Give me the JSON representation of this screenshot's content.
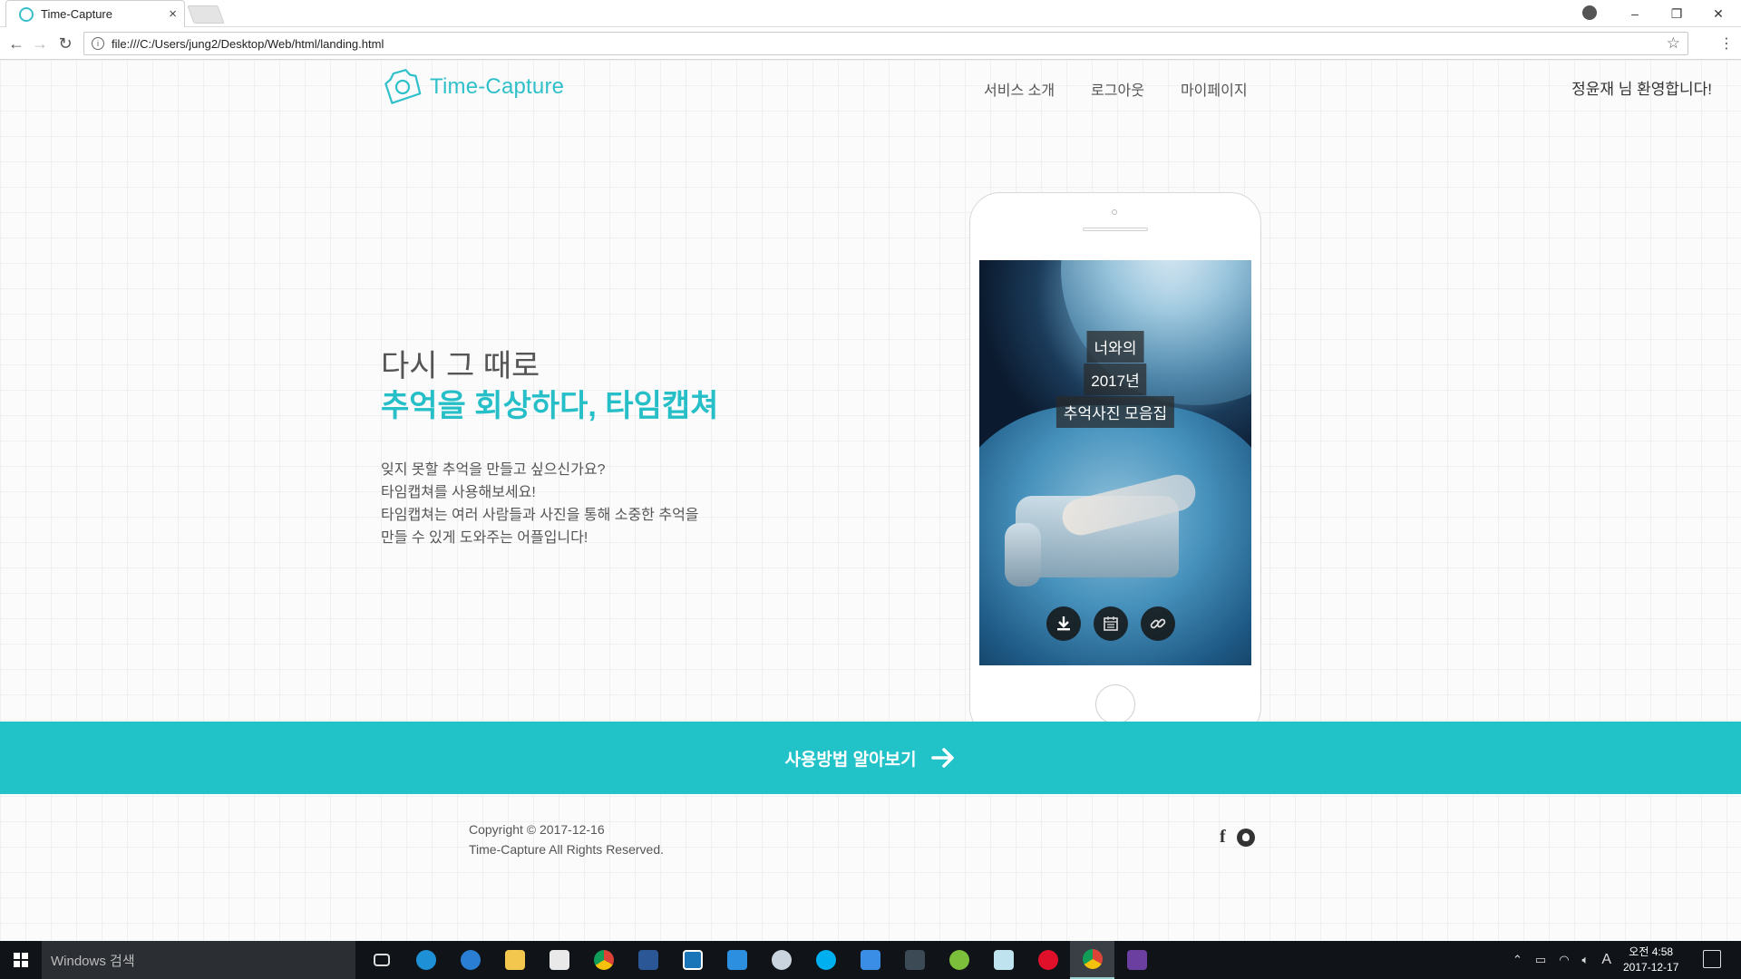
{
  "browser": {
    "tab_title": "Time-Capture",
    "tab_close": "×",
    "address": "file:///C:/Users/jung2/Desktop/Web/html/landing.html",
    "window_controls": [
      "–",
      "❐",
      "✕"
    ]
  },
  "header": {
    "logo_text": "Time-Capture",
    "nav": [
      "서비스 소개",
      "로그아웃",
      "마이페이지"
    ],
    "welcome": "정윤재 님 환영합니다!"
  },
  "hero": {
    "title_line1": "다시 그 때로",
    "title_line2": "추억을 회상하다, 타임캡쳐",
    "desc": [
      "잊지 못할 추억을 만들고 싶으신가요?",
      "타임캡쳐를 사용해보세요!",
      "타임캡쳐는 여러 사람들과 사진을 통해 소중한 추억을",
      "만들 수 있게 도와주는 어플입니다!"
    ]
  },
  "phone_screen": {
    "labels": [
      "너와의",
      "2017년",
      "추억사진 모음집"
    ],
    "icons": [
      "download-icon",
      "calendar-icon",
      "link-icon"
    ]
  },
  "cta": {
    "label": "사용방법 알아보기"
  },
  "footer": {
    "copyright_line1": "Copyright © 2017-12-16",
    "copyright_line2": "Time-Capture All Rights Reserved.",
    "social": [
      "facebook-icon",
      "github-icon"
    ],
    "facebook_glyph": "f"
  },
  "taskbar": {
    "search_placeholder": "Windows 검색",
    "ime": "A",
    "time": "오전 4:58",
    "date": "2017-12-17"
  },
  "colors": {
    "accent": "#22c2c9",
    "text": "#555555",
    "taskbar": "#101418"
  }
}
